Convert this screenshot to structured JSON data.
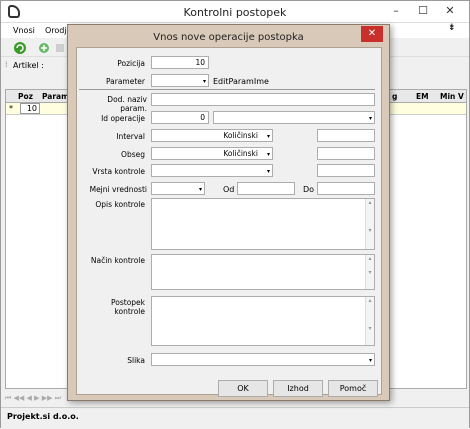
{
  "window": {
    "title": "Kontrolni postopek"
  },
  "menu": {
    "items": [
      "Vnosi",
      "Orodja"
    ]
  },
  "filter": {
    "label": "Artikel :"
  },
  "grid": {
    "headers": [
      "Poz",
      "Parame",
      "g",
      "EM",
      "Min V"
    ],
    "rows": [
      {
        "num": "10"
      }
    ],
    "row_marker": "*"
  },
  "status": {
    "text": "Projekt.si d.o.o."
  },
  "dialog": {
    "title": "Vnos nove operacije postopka",
    "close_symbol": "✕",
    "pozicija": {
      "label": "Pozicija",
      "value": "10"
    },
    "parameter": {
      "label": "Parameter",
      "value": "",
      "extra": "EditParamIme"
    },
    "dod_naziv": {
      "label": "Dod. naziv param.",
      "value": ""
    },
    "id_operacije": {
      "label": "Id operacije",
      "value": "0",
      "select_value": ""
    },
    "interval": {
      "label": "Interval",
      "unit": "Količinski",
      "value": ""
    },
    "obseg": {
      "label": "Obseg",
      "unit": "Količinski",
      "value": ""
    },
    "vrsta_kontrole": {
      "label": "Vrsta kontrole",
      "value": "",
      "extra_value": ""
    },
    "mejni": {
      "label": "Mejni vrednosti",
      "value": "",
      "od_label": "Od",
      "od_value": "",
      "do_label": "Do",
      "do_value": ""
    },
    "opis": {
      "label": "Opis kontrole"
    },
    "nacin": {
      "label": "Način kontrole"
    },
    "postopek": {
      "label": "Postopek kontrole"
    },
    "slika": {
      "label": "Slika",
      "value": ""
    },
    "buttons": {
      "ok": "OK",
      "izhod": "Izhod",
      "pomoc": "Pomoč"
    }
  },
  "icons": {
    "arrow": "▾",
    "scroll_up": "▴",
    "scroll_down": "▾"
  }
}
